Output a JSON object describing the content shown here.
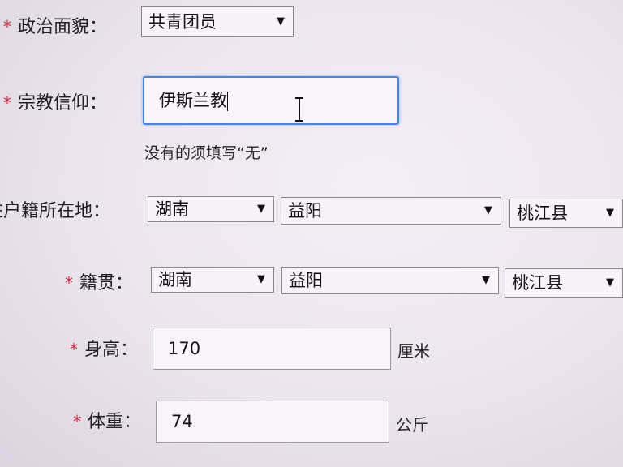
{
  "form": {
    "required_mark": "*",
    "political": {
      "label": "政治面貌：",
      "value": "共青团员"
    },
    "religion": {
      "label": "宗教信仰：",
      "value": "伊斯兰教",
      "hint": "没有的须填写“无”"
    },
    "residence": {
      "label": "住户籍所在地：",
      "province": "湖南",
      "city": "益阳",
      "county": "桃江县"
    },
    "native_place": {
      "label": "籍贯：",
      "province": "湖南",
      "city": "益阳",
      "county": "桃江县"
    },
    "height": {
      "label": "身高：",
      "value": "170",
      "unit": "厘米"
    },
    "weight": {
      "label": "体重：",
      "value": "74",
      "unit": "公斤"
    }
  },
  "icons": {
    "dropdown_arrow": "▼",
    "cursor": "i-beam-cursor-icon"
  }
}
